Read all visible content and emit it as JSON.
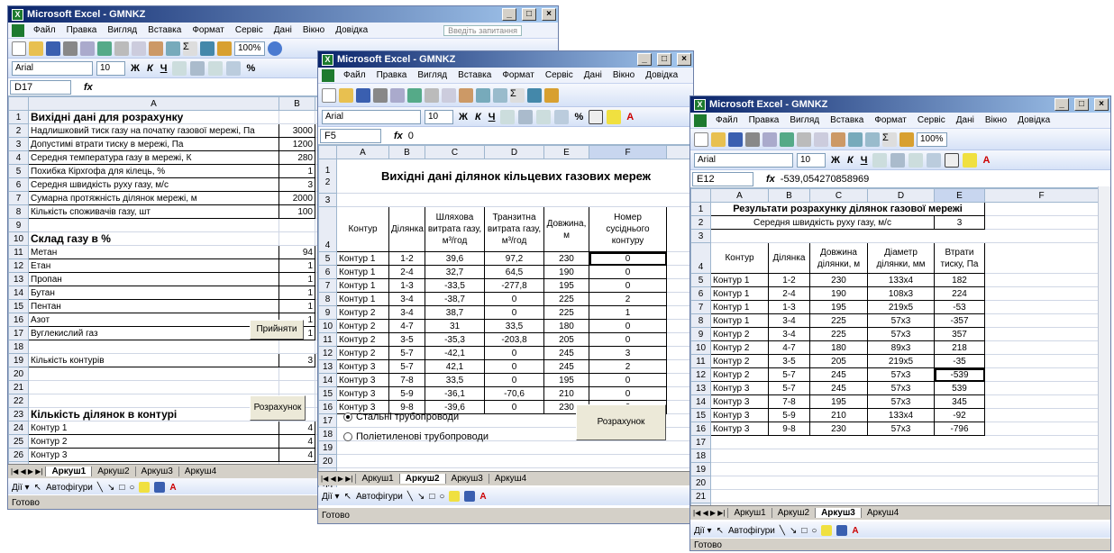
{
  "colors": {
    "title_start": "#0a246a",
    "title_end": "#a6caf0",
    "excel_green": "#1d7a2e"
  },
  "w1": {
    "title": "Microsoft Excel - GMNKZ",
    "menu": [
      "Файл",
      "Правка",
      "Вигляд",
      "Вставка",
      "Формат",
      "Сервіс",
      "Дані",
      "Вікно",
      "Довідка"
    ],
    "help_placeholder": "Введіть запитання",
    "zoom": "100%",
    "font": "Arial",
    "size": "10",
    "namebox": "D17",
    "col_a": "A",
    "col_b": "B",
    "rows": [
      {
        "n": "1",
        "a": "Вихідні дані для розрахунку",
        "b": "",
        "hdr": true
      },
      {
        "n": "2",
        "a": "Надлишковий тиск газу на початку газової мережі, Па",
        "b": "3000"
      },
      {
        "n": "3",
        "a": "Допустимі втрати тиску в мережі, Па",
        "b": "1200"
      },
      {
        "n": "4",
        "a": "Середня температура газу в мережі, К",
        "b": "280"
      },
      {
        "n": "5",
        "a": "Похибка Кірхгофа для кілець, %",
        "b": "1"
      },
      {
        "n": "6",
        "a": "Середня швидкість руху газу, м/с",
        "b": "3"
      },
      {
        "n": "7",
        "a": "Сумарна протяжність ділянок мережі, м",
        "b": "2000"
      },
      {
        "n": "8",
        "a": "Кількість споживачів газу, шт",
        "b": "100"
      },
      {
        "n": "9",
        "a": "",
        "b": ""
      },
      {
        "n": "10",
        "a": "Склад газу в %",
        "b": "",
        "hdr": true
      },
      {
        "n": "11",
        "a": "Метан",
        "b": "94"
      },
      {
        "n": "12",
        "a": "Етан",
        "b": "1"
      },
      {
        "n": "13",
        "a": "Пропан",
        "b": "1"
      },
      {
        "n": "14",
        "a": "Бутан",
        "b": "1"
      },
      {
        "n": "15",
        "a": "Пентан",
        "b": "1"
      },
      {
        "n": "16",
        "a": "Азот",
        "b": "1"
      },
      {
        "n": "17",
        "a": "Вуглекислий газ",
        "b": "1"
      },
      {
        "n": "18",
        "a": "",
        "b": ""
      },
      {
        "n": "19",
        "a": "Кількість контурів",
        "b": "3"
      },
      {
        "n": "20",
        "a": "",
        "b": ""
      },
      {
        "n": "21",
        "a": "",
        "b": ""
      },
      {
        "n": "22",
        "a": "",
        "b": ""
      },
      {
        "n": "23",
        "a": "Кількість ділянок в контурі",
        "b": "",
        "hdr": true
      },
      {
        "n": "24",
        "a": "Контур 1",
        "b": "4"
      },
      {
        "n": "25",
        "a": "Контур 2",
        "b": "4"
      },
      {
        "n": "26",
        "a": "Контур 3",
        "b": "4"
      },
      {
        "n": "27",
        "a": "",
        "b": ""
      },
      {
        "n": "28",
        "a": "",
        "b": ""
      },
      {
        "n": "29",
        "a": "",
        "b": ""
      },
      {
        "n": "30",
        "a": "",
        "b": ""
      },
      {
        "n": "31",
        "a": "",
        "b": ""
      },
      {
        "n": "32",
        "a": "",
        "b": ""
      },
      {
        "n": "33",
        "a": "",
        "b": ""
      }
    ],
    "btn_accept": "Прийняти",
    "btn_calc": "Розрахунок",
    "tabs": [
      "Аркуш1",
      "Аркуш2",
      "Аркуш3",
      "Аркуш4"
    ],
    "autoshapes": "Автофігури",
    "status": "Готово"
  },
  "w2": {
    "title": "Microsoft Excel - GMNKZ",
    "menu": [
      "Файл",
      "Правка",
      "Вигляд",
      "Вставка",
      "Формат",
      "Сервіс",
      "Дані",
      "Вікно",
      "Довідка"
    ],
    "font": "Arial",
    "size": "10",
    "namebox": "F5",
    "formula": "0",
    "cols": [
      "A",
      "B",
      "C",
      "D",
      "E",
      "F"
    ],
    "heading": "Вихідні дані ділянок кільцевих газових мереж",
    "headers": [
      "Контур",
      "Ділянка",
      "Шляхова витрата газу, м³/год",
      "Транзитна витрата газу, м³/год",
      "Довжина, м",
      "Номер сусіднього контуру"
    ],
    "data": [
      [
        "Контур 1",
        "1-2",
        "39,6",
        "97,2",
        "230",
        "0"
      ],
      [
        "Контур 1",
        "2-4",
        "32,7",
        "64,5",
        "190",
        "0"
      ],
      [
        "Контур 1",
        "1-3",
        "-33,5",
        "-277,8",
        "195",
        "0"
      ],
      [
        "Контур 1",
        "3-4",
        "-38,7",
        "0",
        "225",
        "2"
      ],
      [
        "Контур 2",
        "3-4",
        "38,7",
        "0",
        "225",
        "1"
      ],
      [
        "Контур 2",
        "4-7",
        "31",
        "33,5",
        "180",
        "0"
      ],
      [
        "Контур 2",
        "3-5",
        "-35,3",
        "-203,8",
        "205",
        "0"
      ],
      [
        "Контур 2",
        "5-7",
        "-42,1",
        "0",
        "245",
        "3"
      ],
      [
        "Контур 3",
        "5-7",
        "42,1",
        "0",
        "245",
        "2"
      ],
      [
        "Контур 3",
        "7-8",
        "33,5",
        "0",
        "195",
        "0"
      ],
      [
        "Контур 3",
        "5-9",
        "-36,1",
        "-70,6",
        "210",
        "0"
      ],
      [
        "Контур 3",
        "9-8",
        "-39,6",
        "0",
        "230",
        "0"
      ]
    ],
    "radio1": "Стальні трубопроводи",
    "radio2": "Поліетиленові трубопроводи",
    "btn_calc": "Розрахунок",
    "tabs": [
      "Аркуш1",
      "Аркуш2",
      "Аркуш3",
      "Аркуш4"
    ],
    "autoshapes": "Автофігури",
    "status": "Готово"
  },
  "w3": {
    "title": "Microsoft Excel - GMNKZ",
    "menu": [
      "Файл",
      "Правка",
      "Вигляд",
      "Вставка",
      "Формат",
      "Сервіс",
      "Дані",
      "Вікно",
      "Довідка"
    ],
    "font": "Arial",
    "size": "10",
    "zoom": "100%",
    "namebox": "E12",
    "formula": "-539,054270858969",
    "cols": [
      "A",
      "B",
      "C",
      "D",
      "E",
      "F"
    ],
    "heading": "Результати розрахунку ділянок газової мережі",
    "speed_label": "Середня швидкість руху газу, м/с",
    "speed": "3",
    "headers": [
      "Контур",
      "Ділянка",
      "Довжина ділянки, м",
      "Діаметр ділянки, мм",
      "Втрати тиску, Па"
    ],
    "data": [
      [
        "Контур 1",
        "1-2",
        "230",
        "133x4",
        "182"
      ],
      [
        "Контур 1",
        "2-4",
        "190",
        "108x3",
        "224"
      ],
      [
        "Контур 1",
        "1-3",
        "195",
        "219x5",
        "-53"
      ],
      [
        "Контур 1",
        "3-4",
        "225",
        "57x3",
        "-357"
      ],
      [
        "Контур 2",
        "3-4",
        "225",
        "57x3",
        "357"
      ],
      [
        "Контур 2",
        "4-7",
        "180",
        "89x3",
        "218"
      ],
      [
        "Контур 2",
        "3-5",
        "205",
        "219x5",
        "-35"
      ],
      [
        "Контур 2",
        "5-7",
        "245",
        "57x3",
        "-539"
      ],
      [
        "Контур 3",
        "5-7",
        "245",
        "57x3",
        "539"
      ],
      [
        "Контур 3",
        "7-8",
        "195",
        "57x3",
        "345"
      ],
      [
        "Контур 3",
        "5-9",
        "210",
        "133x4",
        "-92"
      ],
      [
        "Контур 3",
        "9-8",
        "230",
        "57x3",
        "-796"
      ]
    ],
    "tabs": [
      "Аркуш1",
      "Аркуш2",
      "Аркуш3",
      "Аркуш4"
    ],
    "autoshapes": "Автофігури",
    "status": "Готово"
  }
}
